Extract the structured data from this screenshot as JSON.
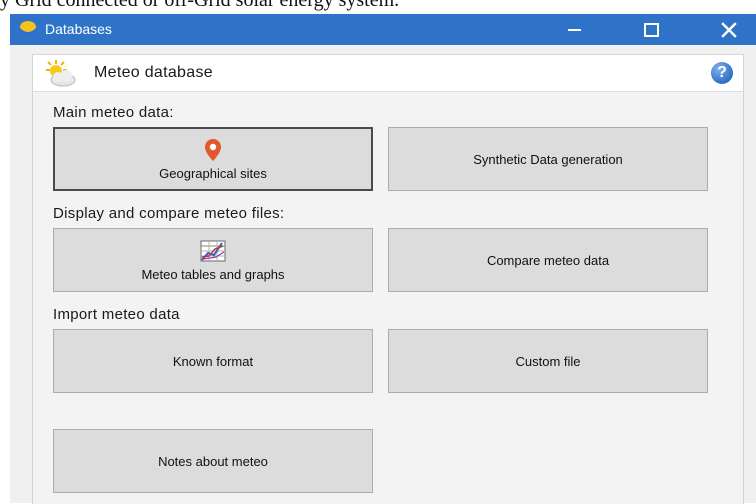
{
  "caption": "y Grid connected or off-Grid solar energy system.",
  "window": {
    "title": "Databases"
  },
  "header": {
    "title": "Meteo database",
    "help_glyph": "?"
  },
  "sections": {
    "main_label": "Main meteo data:",
    "display_label": "Display and compare meteo files:",
    "import_label": "Import meteo data"
  },
  "buttons": {
    "geo_sites": "Geographical sites",
    "synthetic": "Synthetic Data generation",
    "tables_graphs": "Meteo tables and graphs",
    "compare": "Compare meteo data",
    "known_format": "Known format",
    "custom_file": "Custom file",
    "notes": "Notes about meteo"
  },
  "colors": {
    "titlebar": "#2f73c8",
    "button_face": "#dcdcdc",
    "map_pin": "#e0582c"
  },
  "icons": {
    "app": "app-logo-icon",
    "header": "sun-cloud-icon",
    "help": "help-icon",
    "geo": "map-pin-icon",
    "tables": "table-graph-icon"
  }
}
